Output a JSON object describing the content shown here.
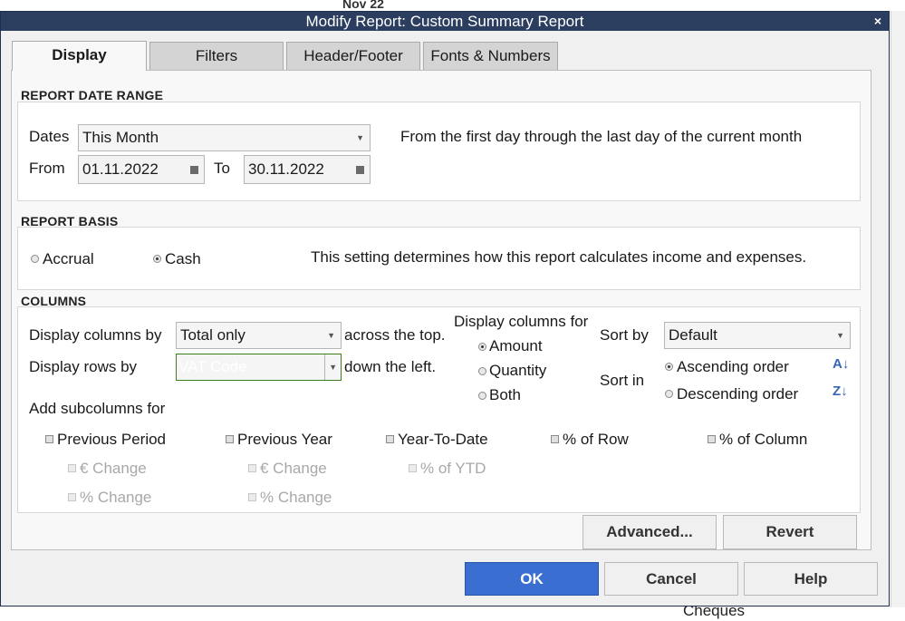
{
  "background": {
    "date_header": "Nov 22",
    "list_item": "Cheques"
  },
  "dialog": {
    "title": "Modify Report: Custom Summary Report",
    "close_glyph": "×",
    "tabs": [
      {
        "label": "Display",
        "active": true
      },
      {
        "label": "Filters",
        "active": false
      },
      {
        "label": "Header/Footer",
        "active": false
      },
      {
        "label": "Fonts & Numbers",
        "active": false
      }
    ]
  },
  "date_range": {
    "title": "REPORT DATE RANGE",
    "dates_label": "Dates",
    "dates_value": "This Month",
    "description": "From the first day through the last day of the current month",
    "from_label": "From",
    "from_value": "01.11.2022",
    "to_label": "To",
    "to_value": "30.11.2022"
  },
  "basis": {
    "title": "REPORT BASIS",
    "accrual_label": "Accrual",
    "cash_label": "Cash",
    "selected": "Cash",
    "description": "This setting determines how this report calculates income and expenses."
  },
  "columns": {
    "title": "COLUMNS",
    "display_columns_by_label": "Display columns by",
    "display_columns_by_value": "Total only",
    "across_top": "across the top.",
    "display_rows_by_label": "Display rows by",
    "display_rows_by_value": "VAT Code",
    "down_left": "down the left.",
    "display_columns_for_label": "Display columns for",
    "amount_label": "Amount",
    "quantity_label": "Quantity",
    "both_label": "Both",
    "columns_for_selected": "Amount",
    "sort_by_label": "Sort by",
    "sort_by_value": "Default",
    "sort_in_label": "Sort in",
    "ascending_label": "Ascending order",
    "descending_label": "Descending order",
    "sort_selected": "Ascending order",
    "subcolumns_label": "Add subcolumns for",
    "previous_period": "Previous Period",
    "previous_year": "Previous Year",
    "year_to_date": "Year-To-Date",
    "pct_row": "% of Row",
    "pct_column": "% of Column",
    "pp_euro_change": "€ Change",
    "pp_pct_change": "% Change",
    "py_euro_change": "€ Change",
    "py_pct_change": "% Change",
    "ytd_pct": "% of YTD",
    "ascending_icon": "sort-ascending-icon",
    "descending_icon": "sort-descending-icon"
  },
  "buttons": {
    "advanced": "Advanced...",
    "revert": "Revert",
    "ok": "OK",
    "cancel": "Cancel",
    "help": "Help"
  },
  "colors": {
    "title_bar": "#2c3e5f",
    "highlight_green": "#57a42b",
    "ok_blue": "#3a6fd1"
  }
}
